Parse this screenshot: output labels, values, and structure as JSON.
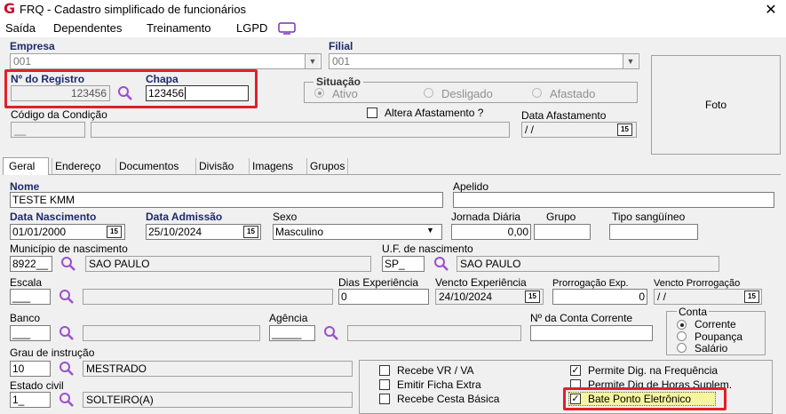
{
  "window": {
    "title": "FRQ - Cadastro simplificado de funcionários",
    "app_icon": "G"
  },
  "menu": [
    "Saída",
    "Dependentes",
    "Treinamento",
    "LGPD"
  ],
  "empresa": {
    "label": "Empresa",
    "value": "001"
  },
  "filial": {
    "label": "Filial",
    "value": "001"
  },
  "registro": {
    "label": "Nº do Registro",
    "value": "123456"
  },
  "chapa": {
    "label": "Chapa",
    "value": "123456"
  },
  "situacao": {
    "label": "Situação",
    "options": [
      "Ativo",
      "Desligado",
      "Afastado"
    ],
    "selected": "Ativo"
  },
  "foto": {
    "label": "Foto"
  },
  "codigo_condicao": {
    "label": "Código da Condição",
    "value": "__",
    "desc": ""
  },
  "altera_afastamento": {
    "label": "Altera Afastamento ?",
    "checked": false
  },
  "data_afastamento": {
    "label": "Data Afastamento",
    "value": "/ /"
  },
  "tabs": [
    "Geral",
    "Endereço",
    "Documentos",
    "Divisão",
    "Imagens",
    "Grupos"
  ],
  "geral": {
    "nome": {
      "label": "Nome",
      "value": "TESTE KMM"
    },
    "apelido": {
      "label": "Apelido",
      "value": ""
    },
    "data_nascimento": {
      "label": "Data Nascimento",
      "value": "01/01/2000"
    },
    "data_admissao": {
      "label": "Data Admissão",
      "value": "25/10/2024"
    },
    "sexo": {
      "label": "Sexo",
      "value": "Masculino"
    },
    "jornada": {
      "label": "Jornada Diária",
      "value": "0,00"
    },
    "grupo": {
      "label": "Grupo",
      "value": ""
    },
    "tipo_sanguineo": {
      "label": "Tipo sangüíneo",
      "value": ""
    },
    "municipio": {
      "label": "Município de nascimento",
      "code": "8922__",
      "desc": "SAO PAULO"
    },
    "uf": {
      "label": "U.F. de nascimento",
      "code": "SP_",
      "desc": "SAO PAULO"
    },
    "escala": {
      "label": "Escala",
      "code": "___",
      "desc": ""
    },
    "dias_experiencia": {
      "label": "Dias Experiência",
      "value": "0"
    },
    "vencto_experiencia": {
      "label": "Vencto Experiência",
      "value": "24/10/2024"
    },
    "prorrogacao_exp": {
      "label": "Prorrogação Exp.",
      "value": "0"
    },
    "vencto_prorrogacao": {
      "label": "Vencto Prorrogação",
      "value": "/ /"
    },
    "banco": {
      "label": "Banco",
      "code": "___",
      "desc": ""
    },
    "agencia": {
      "label": "Agência",
      "code": "_____",
      "desc": ""
    },
    "conta": {
      "label": "Nº da Conta Corrente",
      "value": ""
    },
    "tipo_conta": {
      "label": "Conta",
      "options": [
        "Corrente",
        "Poupança",
        "Salário"
      ],
      "selected": "Corrente"
    },
    "grau_instrucao": {
      "label": "Grau de instrução",
      "code": "10",
      "desc": "MESTRADO"
    },
    "estado_civil": {
      "label": "Estado civil",
      "code": "1_",
      "desc": "SOLTEIRO(A)"
    },
    "checks_left": [
      {
        "label": "Recebe VR / VA",
        "checked": false
      },
      {
        "label": "Emitir Ficha Extra",
        "checked": false
      },
      {
        "label": "Recebe Cesta Básica",
        "checked": false
      }
    ],
    "checks_right": [
      {
        "label": "Permite Dig. na Frequência",
        "checked": true
      },
      {
        "label": "Permite Dig de Horas Suplem.",
        "checked": false
      },
      {
        "label": "Bate Ponto Eletrônico",
        "checked": true
      }
    ]
  },
  "colors": {
    "highlight": "#e0202a",
    "label_navy": "#1d2a6b",
    "checkbox_highlight": "#f5f5a0"
  }
}
